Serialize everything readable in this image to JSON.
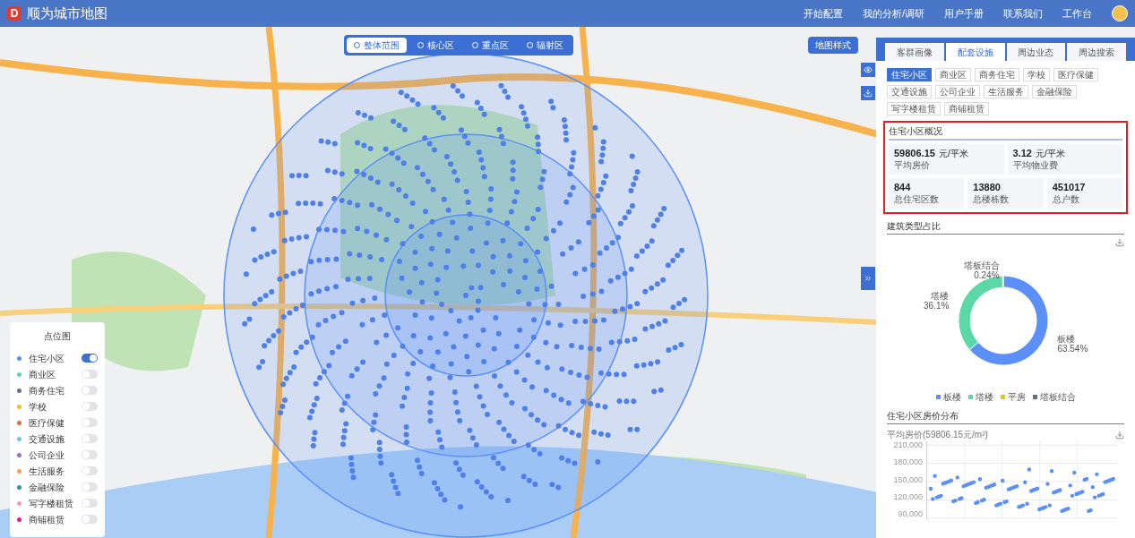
{
  "header": {
    "title": "顺为城市地图",
    "logo": "D",
    "nav": [
      "开始配置",
      "我的分析/调研",
      "用户手册",
      "联系我们",
      "工作台"
    ]
  },
  "map_toolbar": {
    "ranges": [
      {
        "label": "整体范围",
        "selected": true
      },
      {
        "label": "核心区",
        "selected": false
      },
      {
        "label": "重点区",
        "selected": false
      },
      {
        "label": "辐射区",
        "selected": false
      }
    ],
    "style_button": "地图样式"
  },
  "legend": {
    "title": "点位图",
    "items": [
      {
        "label": "住宅小区",
        "color": "#5b8ff9",
        "on": true
      },
      {
        "label": "商业区",
        "color": "#5ad8a6",
        "on": false
      },
      {
        "label": "商务住宅",
        "color": "#5d7092",
        "on": false
      },
      {
        "label": "学校",
        "color": "#f6bd16",
        "on": false
      },
      {
        "label": "医疗保健",
        "color": "#e8684a",
        "on": false
      },
      {
        "label": "交通设施",
        "color": "#6dc8ec",
        "on": false
      },
      {
        "label": "公司企业",
        "color": "#9270ca",
        "on": false
      },
      {
        "label": "生活服务",
        "color": "#ff9d4d",
        "on": false
      },
      {
        "label": "金融保险",
        "color": "#269a99",
        "on": false
      },
      {
        "label": "写字楼租赁",
        "color": "#ff99c3",
        "on": false
      },
      {
        "label": "商铺租赁",
        "color": "#e8149b",
        "on": false
      }
    ]
  },
  "panel": {
    "tabs": [
      {
        "label": "客群画像",
        "selected": false
      },
      {
        "label": "配套设施",
        "selected": true
      },
      {
        "label": "周边业态",
        "selected": false
      },
      {
        "label": "周边搜索",
        "selected": false
      }
    ],
    "categories": [
      {
        "label": "住宅小区",
        "selected": true
      },
      {
        "label": "商业区",
        "selected": false
      },
      {
        "label": "商务住宅",
        "selected": false
      },
      {
        "label": "学校",
        "selected": false
      },
      {
        "label": "医疗保健",
        "selected": false
      },
      {
        "label": "交通设施",
        "selected": false
      },
      {
        "label": "公司企业",
        "selected": false
      },
      {
        "label": "生活服务",
        "selected": false
      },
      {
        "label": "金融保险",
        "selected": false
      },
      {
        "label": "写字楼租赁",
        "selected": false
      },
      {
        "label": "商铺租赁",
        "selected": false
      }
    ],
    "overview": {
      "title": "住宅小区概况",
      "stats": [
        {
          "value": "59806.15",
          "unit": "元/平米",
          "label": "平均房价"
        },
        {
          "value": "3.12",
          "unit": "元/平米",
          "label": "平均物业费"
        },
        {
          "value": "844",
          "label": "总住宅区数"
        },
        {
          "value": "13880",
          "label": "总楼栋数"
        },
        {
          "value": "451017",
          "label": "总户数"
        }
      ]
    },
    "building_types": {
      "title": "建筑类型占比",
      "chart_data": {
        "type": "donut",
        "categories": [
          "板楼",
          "塔楼",
          "平房",
          "塔板结合"
        ],
        "series": [
          {
            "values": [
              63.54,
              36.1,
              0,
              0.24
            ]
          }
        ],
        "colors": [
          "#5b8ff9",
          "#5ad8a6",
          "#f6bd16",
          "#5d7092"
        ],
        "value_labels": [
          "63.54%",
          "36.1%",
          null,
          "0.24%"
        ]
      }
    },
    "price_distribution": {
      "title": "住宅小区房价分布",
      "plot": {
        "title": "平均房价(59806.15元/m²)",
        "y_labels": [
          "210,000",
          "180,000",
          "150,000",
          "120,000",
          "90,000"
        ]
      }
    }
  }
}
